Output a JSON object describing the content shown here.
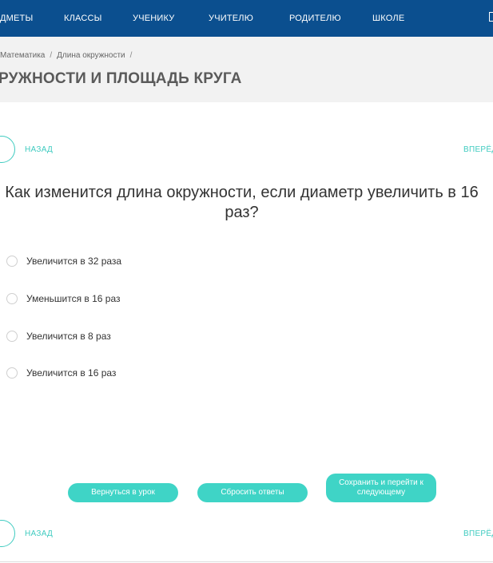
{
  "topnav": {
    "items": [
      {
        "label": "ДМЕТЫ"
      },
      {
        "label": "КЛАССЫ"
      },
      {
        "label": "УЧЕНИКУ"
      },
      {
        "label": "УЧИТЕЛЮ"
      },
      {
        "label": "РОДИТЕЛЮ"
      },
      {
        "label": "ШКОЛЕ"
      }
    ],
    "icon": "document-icon"
  },
  "breadcrumb": {
    "items": [
      "Математика",
      "Длина окружности"
    ],
    "separator": "/"
  },
  "page_title": "РУЖНОСТИ И ПЛОЩАДЬ КРУГА",
  "nav": {
    "back_label": "НАЗАД",
    "forward_label": "ВПЕРЁД"
  },
  "question": {
    "text": "Как изменится длина окружности, если диаметр увеличить в 16 раз?",
    "options": [
      "Увеличится в 32 раза",
      "Уменьшится в 16 раз",
      "Увеличится в 8 раз",
      "Увеличится в 16 раз"
    ]
  },
  "buttons": {
    "return": "Вернуться в урок",
    "reset": "Сбросить ответы",
    "save_next": "Сохранить и перейти к следующему"
  },
  "colors": {
    "nav_bg": "#0b4f8f",
    "accent": "#3fcbc0",
    "button_bg": "#3fd4c6",
    "header_bg": "#f2f2f2"
  }
}
